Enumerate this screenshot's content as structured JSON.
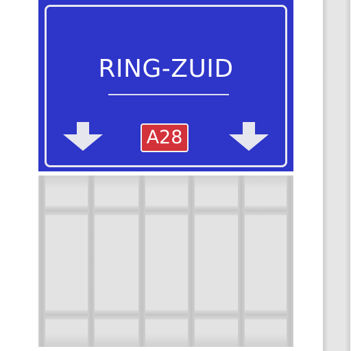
{
  "sign": {
    "destination": "RING-ZUID",
    "route_number": "A28",
    "background_color": "#2e35c9",
    "route_badge_color": "#d3323a",
    "arrows": [
      "arrow-down-icon",
      "arrow-down-icon"
    ]
  }
}
